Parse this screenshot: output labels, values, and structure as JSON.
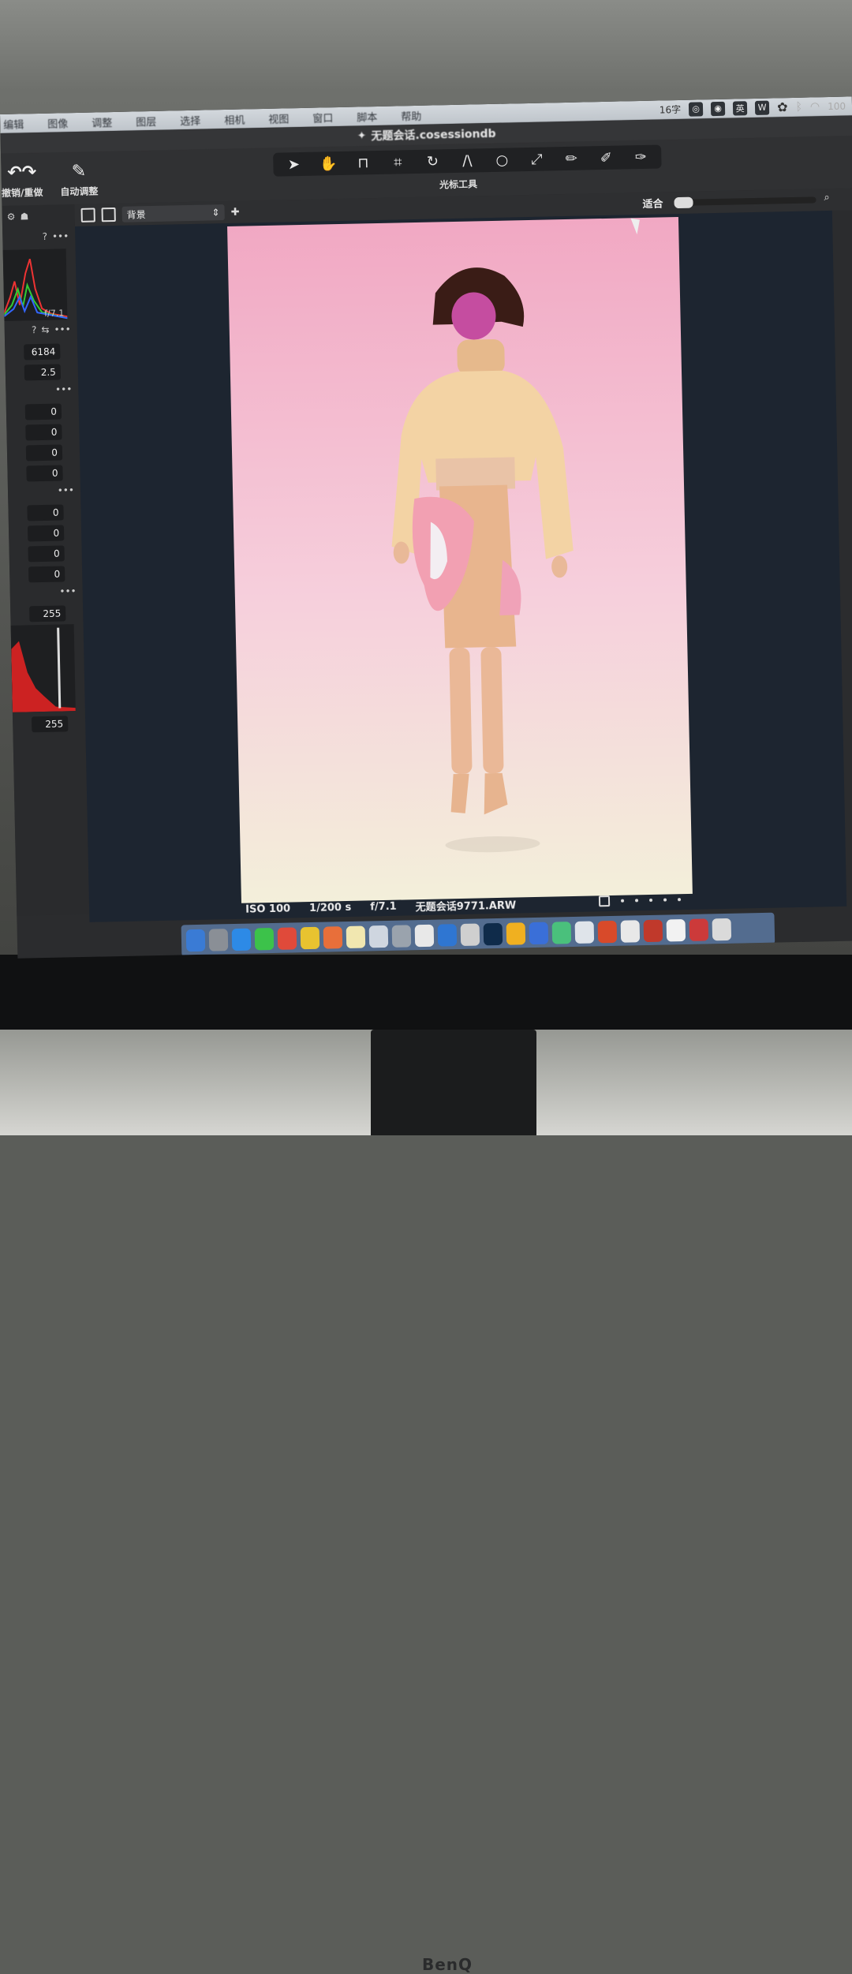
{
  "menu": [
    "编辑",
    "图像",
    "调整",
    "图层",
    "选择",
    "相机",
    "视图",
    "窗口",
    "脚本",
    "帮助"
  ],
  "status": {
    "input_method": "16字",
    "ime_char": "英",
    "battery": "100"
  },
  "window": {
    "title": "无题会话.cosessiondb"
  },
  "left_actions": [
    {
      "label": "撤销/重做"
    },
    {
      "label": "自动调整"
    }
  ],
  "tools_label": "光标工具",
  "viewer": {
    "layer": "背景",
    "fit_label": "适合"
  },
  "sidebar": {
    "histogram_label": "f/7.1",
    "values": [
      "6184",
      "2.5",
      "0",
      "0",
      "0",
      "0",
      "0",
      "0",
      "0",
      "0",
      "255"
    ],
    "levels_value": "255"
  },
  "photo_info": {
    "iso": "ISO 100",
    "shutter": "1/200 s",
    "aperture": "f/7.1",
    "filename": "无题会话9771.ARW"
  },
  "monitor_brand": "BenQ",
  "colors": {
    "accent": "#f0a23a",
    "photo_top": "#f1a8c3",
    "photo_bottom": "#f3efda"
  }
}
